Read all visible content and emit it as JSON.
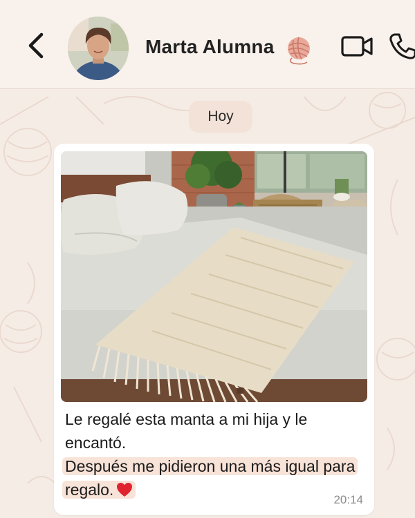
{
  "header": {
    "contact_name": "Marta Alumna",
    "back_icon": "chevron-left-icon",
    "name_emoji_icon": "yarn-ball-icon",
    "video_icon": "video-camera-icon",
    "call_icon": "phone-icon"
  },
  "chat": {
    "date_label": "Hoy",
    "message": {
      "line1": "Le regalé esta manta a mi hija y le encantó.",
      "line2": "Después me pidieron una más igual para regalo.",
      "heart_icon": "red-heart-icon",
      "time": "20:14"
    }
  },
  "colors": {
    "background": "#f6ece6",
    "bubble": "#ffffff",
    "highlight": "#f8e3d8",
    "date_chip": "#f3e2d8",
    "heart": "#e0242f"
  }
}
